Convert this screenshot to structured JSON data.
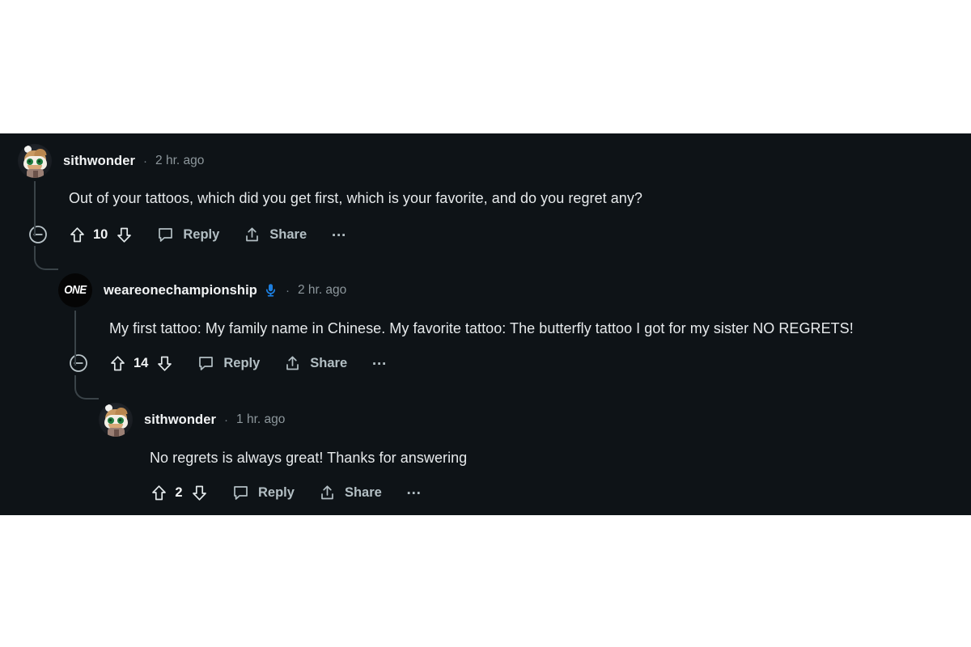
{
  "theme": {
    "panel_bg": "#0e1317",
    "page_bg": "#ffffff",
    "text_primary": "#e7eaec",
    "text_muted": "#8d979c",
    "action_label": "#b3bfc4",
    "thread_line": "#3a4348",
    "badge_blue": "#1d7fe0"
  },
  "thread": {
    "comments": [
      {
        "id": "c0",
        "depth": 0,
        "author": "sithwonder",
        "avatar": "snoo-avatar",
        "is_op": false,
        "separator": "·",
        "timestamp": "2 hr. ago",
        "body": "Out of your tattoos, which did you get first, which is your favorite, and do you regret any?",
        "has_collapse": true,
        "score": "10",
        "reply_label": "Reply",
        "share_label": "Share",
        "more_label": "…"
      },
      {
        "id": "c1",
        "depth": 1,
        "author": "weareonechampionship",
        "avatar": "one-championship-logo",
        "avatar_text": "ONE",
        "is_op": true,
        "op_badge": "microphone-icon",
        "separator": "·",
        "timestamp": "2 hr. ago",
        "body": "My first tattoo: My family name in Chinese. My favorite tattoo: The butterfly tattoo I got for my sister NO REGRETS!",
        "has_collapse": true,
        "score": "14",
        "reply_label": "Reply",
        "share_label": "Share",
        "more_label": "…"
      },
      {
        "id": "c2",
        "depth": 2,
        "author": "sithwonder",
        "avatar": "snoo-avatar",
        "is_op": false,
        "separator": "·",
        "timestamp": "1 hr. ago",
        "body": "No regrets is always great! Thanks for answering",
        "has_collapse": false,
        "score": "2",
        "reply_label": "Reply",
        "share_label": "Share",
        "more_label": "…"
      }
    ]
  }
}
